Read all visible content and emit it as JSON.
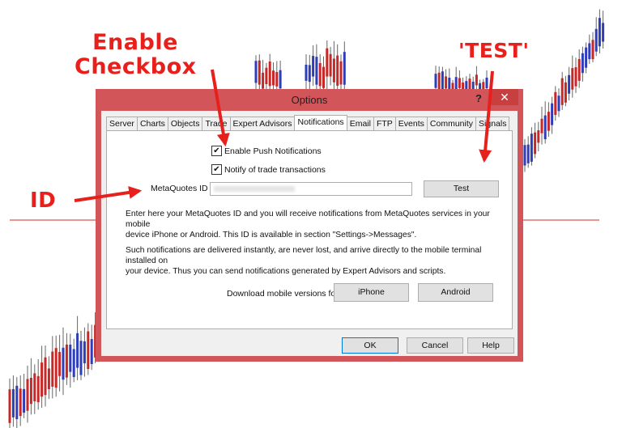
{
  "annotations": {
    "enable_checkbox_line1": "Enable",
    "enable_checkbox_line2": "Checkbox",
    "test": "'TEST'",
    "id": "ID"
  },
  "colors": {
    "accent": "#e8201c",
    "dialog_border": "#d2555a",
    "close_button": "#c7403f"
  },
  "dialog": {
    "title": "Options",
    "help_symbol": "?",
    "close_symbol": "✕",
    "tabs": [
      {
        "label": "Server"
      },
      {
        "label": "Charts"
      },
      {
        "label": "Objects"
      },
      {
        "label": "Trade"
      },
      {
        "label": "Expert Advisors"
      },
      {
        "label": "Notifications",
        "active": true
      },
      {
        "label": "Email"
      },
      {
        "label": "FTP"
      },
      {
        "label": "Events"
      },
      {
        "label": "Community"
      },
      {
        "label": "Signals"
      }
    ],
    "enable_push_label": "Enable Push Notifications",
    "notify_trade_label": "Notify of trade transactions",
    "metaquotes_id_label": "MetaQuotes ID",
    "metaquotes_id_value": "",
    "test_button": "Test",
    "paragraph1_line1": "Enter here your MetaQuotes ID and you will receive notifications from MetaQuotes services in your mobile",
    "paragraph1_line2": "device iPhone or Android. This ID is available in section \"Settings->Messages\".",
    "paragraph2_line1": "Such notifications are delivered instantly, are never lost, and arrive directly to the mobile terminal installed on",
    "paragraph2_line2": "your device. Thus you can send notifications generated by Expert Advisors and scripts.",
    "download_label": "Download mobile versions for:",
    "iphone_button": "iPhone",
    "android_button": "Android",
    "ok_button": "OK",
    "cancel_button": "Cancel",
    "help_button": "Help"
  }
}
